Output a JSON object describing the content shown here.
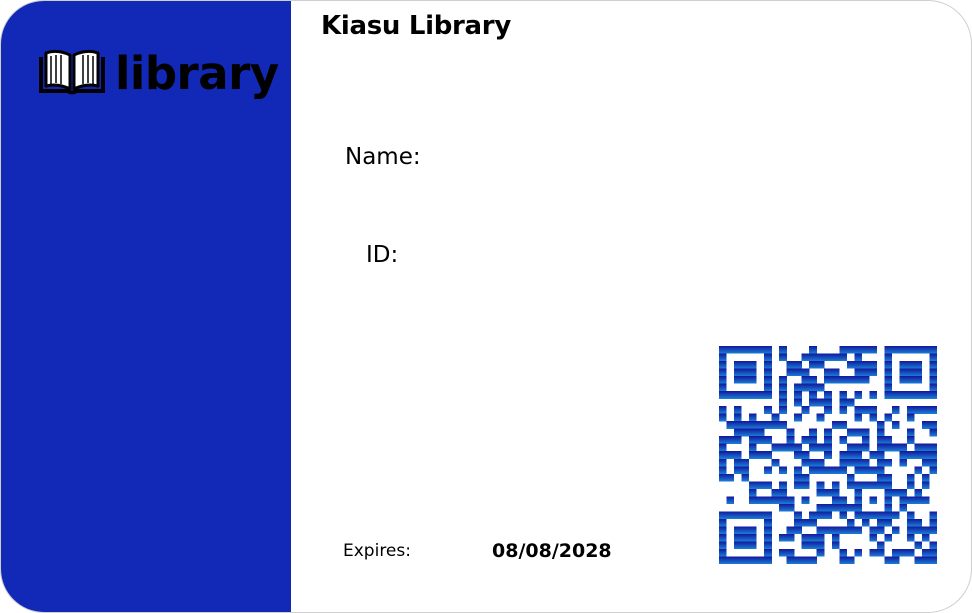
{
  "card": {
    "title": "Kiasu Library",
    "brand_color": "#1229B8"
  },
  "logo": {
    "icon": "open-book-icon",
    "text": "library"
  },
  "fields": {
    "name_label": "Name:",
    "name_value": "",
    "id_label": "ID:",
    "id_value": ""
  },
  "expiry": {
    "label": "Expires:",
    "value": "08/08/2028"
  },
  "qr_code": {
    "icon": "qr-code-icon",
    "gradient_top": "#12179E",
    "gradient_bottom": "#1A7FD6"
  }
}
